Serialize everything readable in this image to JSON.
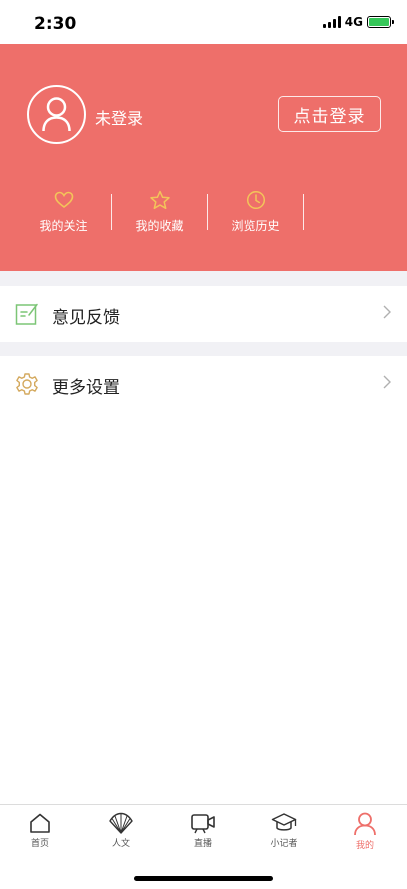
{
  "status_bar": {
    "time": "2:30",
    "network": "4G"
  },
  "profile": {
    "login_status": "未登录",
    "login_button": "点击登录",
    "quick_links": [
      {
        "label": "我的关注",
        "icon": "heart-icon"
      },
      {
        "label": "我的收藏",
        "icon": "star-icon"
      },
      {
        "label": "浏览历史",
        "icon": "clock-icon"
      }
    ]
  },
  "menu": [
    {
      "label": "意见反馈",
      "icon": "feedback-icon"
    },
    {
      "label": "更多设置",
      "icon": "gear-icon"
    }
  ],
  "tab_bar": [
    {
      "label": "首页",
      "icon": "home-icon",
      "active": false
    },
    {
      "label": "人文",
      "icon": "fan-icon",
      "active": false
    },
    {
      "label": "直播",
      "icon": "video-camera-icon",
      "active": false
    },
    {
      "label": "小记者",
      "icon": "graduation-cap-icon",
      "active": false
    },
    {
      "label": "我的",
      "icon": "person-icon",
      "active": true
    }
  ],
  "colors": {
    "accent": "#ee6f6a",
    "icon_yellow": "#f3c45a",
    "feedback_green": "#7cc576",
    "settings_gold": "#d4a95e",
    "tab_gray": "#555555",
    "page_gap": "#f1f1f5"
  }
}
